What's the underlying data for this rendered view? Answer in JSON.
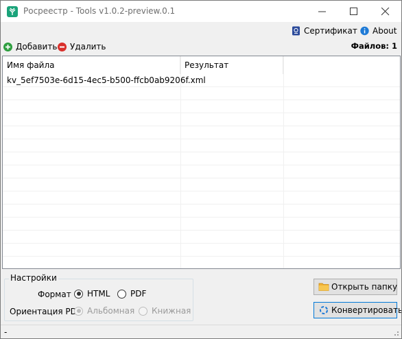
{
  "window": {
    "title": "Росреестр - Tools v1.0.2-preview.0.1"
  },
  "menubar": {
    "certificate_label": "Сертификат",
    "about_label": "About"
  },
  "toolbar": {
    "add_label": "Добавить",
    "delete_label": "Удалить",
    "files_count": "Файлов: 1"
  },
  "grid": {
    "columns": [
      "Имя файла",
      "Результат"
    ],
    "rows": [
      {
        "name": "kv_5ef7503e-6d15-4ec5-b500-ffcb0ab9206f.xml",
        "result": ""
      }
    ]
  },
  "settings": {
    "legend": "Настройки",
    "format_label": "Формат",
    "format_options": [
      "HTML",
      "PDF"
    ],
    "format_selected": "HTML",
    "orientation_label": "Ориентация PDF",
    "orientation_options": [
      "Альбомная",
      "Книжная"
    ],
    "orientation_selected": "Альбомная",
    "orientation_enabled": false
  },
  "actions": {
    "open_folder_label": "Открыть папку",
    "convert_label": "Конвертировать"
  },
  "status": {
    "text": "-"
  },
  "colors": {
    "app_icon": "#1aa37a",
    "add_icon": "#2e9e3f",
    "delete_icon": "#d9302c",
    "certificate_icon": "#2b4a9a",
    "about_icon": "#1e7ad6",
    "folder_icon": "#f2b134",
    "convert_icon": "#1e7ad6",
    "accent_border": "#0078d7"
  }
}
